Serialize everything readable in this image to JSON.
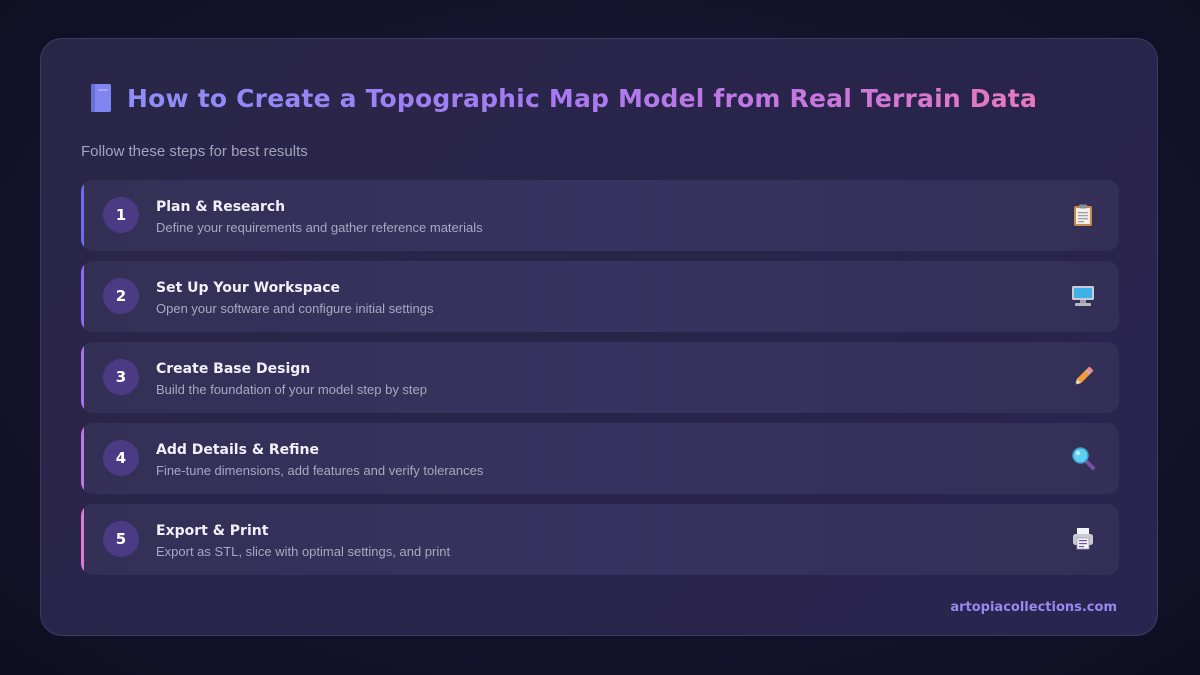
{
  "header": {
    "title": "How to Create a Topographic Map Model from Real Terrain Data",
    "title_icon": "notebook-icon",
    "subtitle": "Follow these steps for best results"
  },
  "steps": [
    {
      "number": "1",
      "title": "Plan & Research",
      "description": "Define your requirements and gather reference materials",
      "icon": "clipboard-icon",
      "accent": "#6e6cf0"
    },
    {
      "number": "2",
      "title": "Set Up Your Workspace",
      "description": "Open your software and configure initial settings",
      "icon": "computer-icon",
      "accent": "#8f6df0"
    },
    {
      "number": "3",
      "title": "Create Base Design",
      "description": "Build the foundation of your model step by step",
      "icon": "pencil-icon",
      "accent": "#a874ee"
    },
    {
      "number": "4",
      "title": "Add Details & Refine",
      "description": "Fine-tune dimensions, add features and verify tolerances",
      "icon": "magnifier-icon",
      "accent": "#c178e6"
    },
    {
      "number": "5",
      "title": "Export & Print",
      "description": "Export as STL, slice with optimal settings, and print",
      "icon": "printer-icon",
      "accent": "#df7ad4"
    }
  ],
  "footer": {
    "site": "artopiacollections.com"
  },
  "colors": {
    "number_badge": "#4b3b85",
    "footer_text": "#9b87f0"
  }
}
